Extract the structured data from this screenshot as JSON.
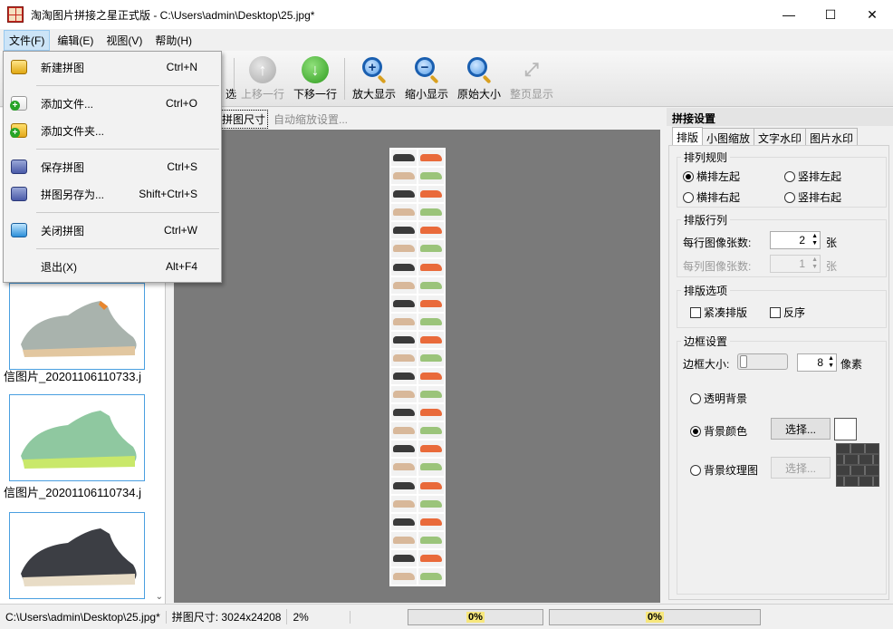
{
  "window": {
    "title": "淘淘图片拼接之星正式版 - C:\\Users\\admin\\Desktop\\25.jpg*",
    "minimize": "—",
    "maximize": "☐",
    "close": "✕"
  },
  "menubar": {
    "items": [
      "文件(F)",
      "编辑(E)",
      "视图(V)",
      "帮助(H)"
    ]
  },
  "file_menu": {
    "items": [
      {
        "label": "新建拼图",
        "shortcut": "Ctrl+N",
        "icon": "new-collage-icon"
      },
      {
        "label": "添加文件...",
        "shortcut": "Ctrl+O",
        "icon": "add-file-icon"
      },
      {
        "label": "添加文件夹...",
        "shortcut": "",
        "icon": "add-folder-icon"
      },
      {
        "label": "保存拼图",
        "shortcut": "Ctrl+S",
        "icon": "save-icon"
      },
      {
        "label": "拼图另存为...",
        "shortcut": "Shift+Ctrl+S",
        "icon": "save-as-icon"
      },
      {
        "label": "关闭拼图",
        "shortcut": "Ctrl+W",
        "icon": "close-collage-icon"
      },
      {
        "label": "退出(X)",
        "shortcut": "Alt+F4",
        "icon": ""
      }
    ]
  },
  "toolbar": {
    "partial_label": "选",
    "move_up": "上移一行",
    "move_down": "下移一行",
    "zoom_in": "放大显示",
    "zoom_out": "缩小显示",
    "original_size": "原始大小",
    "fit_page": "整页显示"
  },
  "left_panel": {
    "captions": [
      "信图片_20201106110733.j",
      "信图片_20201106110734.j"
    ]
  },
  "center": {
    "limit_option": "放以限制拼图尺寸",
    "auto_zoom": "自动缩放设置..."
  },
  "right_panel": {
    "title": "拼接设置",
    "tabs": [
      "排版",
      "小图缩放",
      "文字水印",
      "图片水印"
    ],
    "arrange_rule": {
      "title": "排列规则",
      "options": [
        "横排左起",
        "竖排左起",
        "横排右起",
        "竖排右起"
      ],
      "selected": "横排左起"
    },
    "rows_cols": {
      "title": "排版行列",
      "per_row_label": "每行图像张数:",
      "per_row_value": "2",
      "per_col_label": "每列图像张数:",
      "per_col_value": "1",
      "unit": "张"
    },
    "layout_options": {
      "title": "排版选项",
      "compact": "紧凑排版",
      "reverse": "反序"
    },
    "border": {
      "title": "边框设置",
      "size_label": "边框大小:",
      "size_value": "8",
      "unit": "像素",
      "transparent": "透明背景",
      "bg_color": "背景颜色",
      "bg_texture": "背景纹理图",
      "choose": "选择...",
      "selected": "背景颜色",
      "bg_color_value": "#ffffff"
    }
  },
  "statusbar": {
    "path": "C:\\Users\\admin\\Desktop\\25.jpg*",
    "size": "拼图尺寸: 3024x24208",
    "zoom": "2%",
    "progress1_text": "0%",
    "progress1": 0,
    "progress2_text": "0%",
    "progress2": 0
  }
}
